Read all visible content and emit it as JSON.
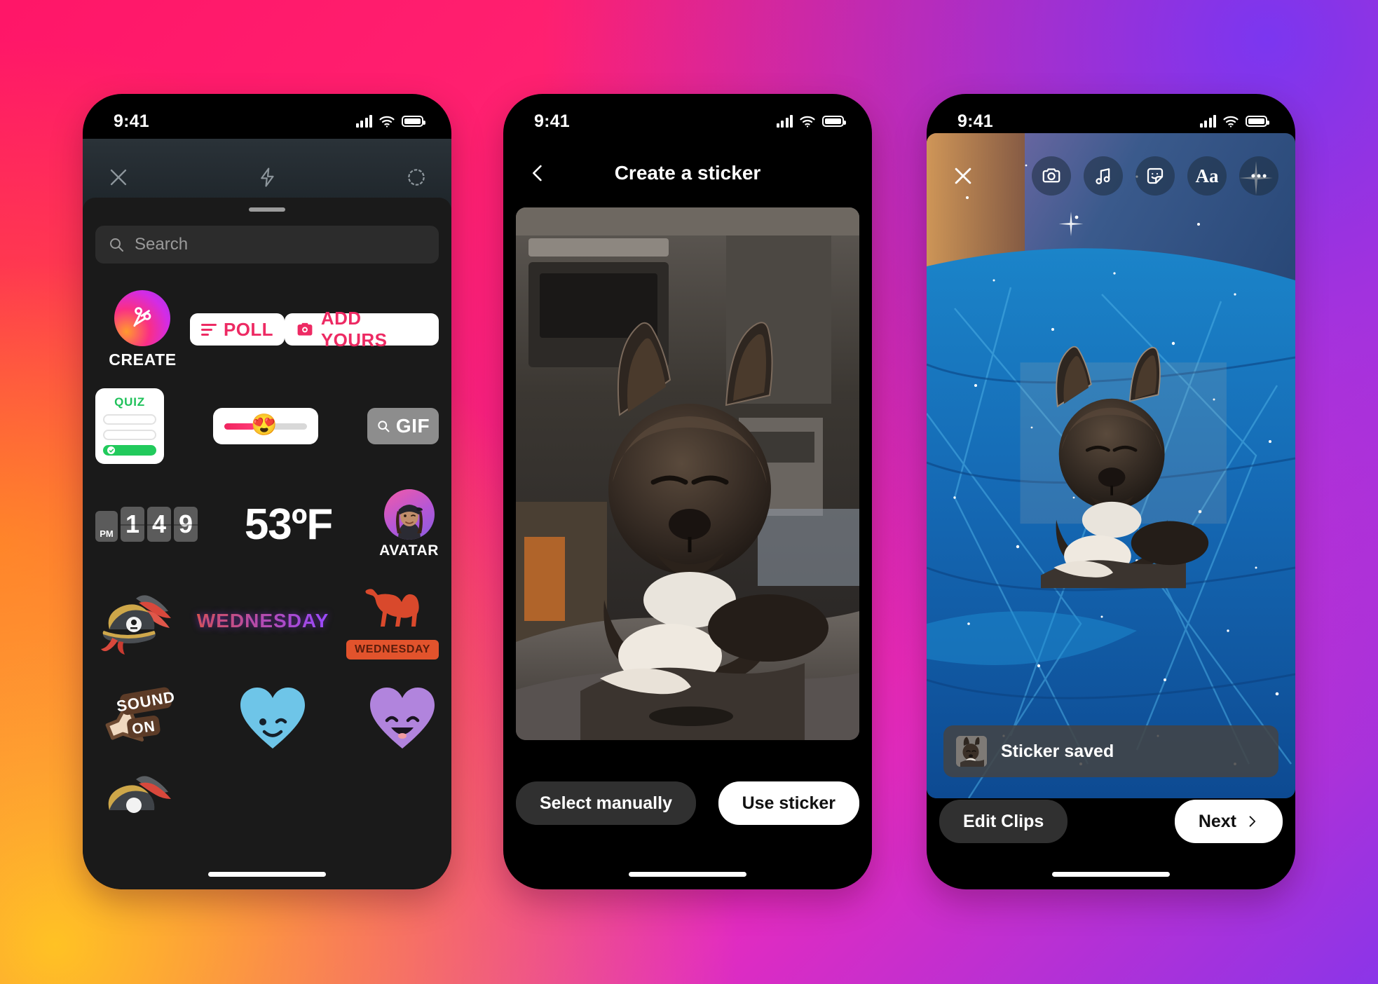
{
  "background": {
    "colors": [
      "#ff1668",
      "#ffc224",
      "#ff5b2e",
      "#8b35e8",
      "#e32bc0"
    ]
  },
  "phones": {
    "sticker_tray": {
      "status_bar": {
        "time": "9:41",
        "signal_icon": "cellular-bars-icon",
        "wifi_icon": "wifi-icon",
        "battery_icon": "battery-icon"
      },
      "camera_bar": {
        "close_icon": "close-icon",
        "flash_icon": "flash-icon",
        "settings_icon": "settings-icon"
      },
      "search": {
        "placeholder": "Search",
        "icon": "search-icon"
      },
      "stickers": {
        "create": {
          "label": "CREATE",
          "icon": "scissors-cut-icon"
        },
        "poll": {
          "label": "POLL",
          "icon": "poll-lines-icon"
        },
        "add_yours": {
          "label": "ADD YOURS",
          "icon": "camera-icon"
        },
        "quiz": {
          "label": "QUIZ",
          "options": 3,
          "correct_index": 3
        },
        "slider": {
          "emoji": "😍",
          "fill_percent": 37
        },
        "gif": {
          "label": "GIF",
          "icon": "search-icon"
        },
        "clock": {
          "meridiem": "PM",
          "digits": [
            "1",
            "4",
            "9"
          ]
        },
        "temperature": {
          "value": "53ºF"
        },
        "avatar": {
          "label": "AVATAR"
        },
        "pirate_hat": {
          "name": "pirate-hat-sticker"
        },
        "wednesday_text": {
          "label": "WEDNESDAY"
        },
        "camel": {
          "label": "WEDNESDAY",
          "name": "camel-sticker"
        },
        "sound_on": {
          "label": "SOUND ON"
        },
        "heart_wink": {
          "name": "blue-winking-heart-sticker",
          "color": "#6ec5e8"
        },
        "heart_smile": {
          "name": "purple-smiling-heart-sticker",
          "color": "#b184dd"
        }
      }
    },
    "create_sticker": {
      "status_bar": {
        "time": "9:41"
      },
      "header": {
        "title": "Create a sticker",
        "back_icon": "chevron-left-icon"
      },
      "photo": {
        "subject": "french-bulldog-photo"
      },
      "actions": {
        "secondary": "Select manually",
        "primary": "Use sticker"
      }
    },
    "story_editor": {
      "status_bar": {
        "time": "9:41"
      },
      "toolbar": {
        "close_icon": "close-icon",
        "items": [
          {
            "name": "camera-icon"
          },
          {
            "name": "music-icon"
          },
          {
            "name": "sticker-icon"
          },
          {
            "name": "text-icon",
            "label": "Aa"
          },
          {
            "name": "more-icon"
          }
        ]
      },
      "canvas": {
        "background": "starry-blue-blanket-photo",
        "sticker": "french-bulldog-cutout-sticker"
      },
      "toast": {
        "message": "Sticker saved",
        "thumbnail": "french-bulldog-cutout-thumb"
      },
      "actions": {
        "secondary": "Edit Clips",
        "primary": "Next",
        "primary_icon": "chevron-right-icon"
      }
    }
  }
}
